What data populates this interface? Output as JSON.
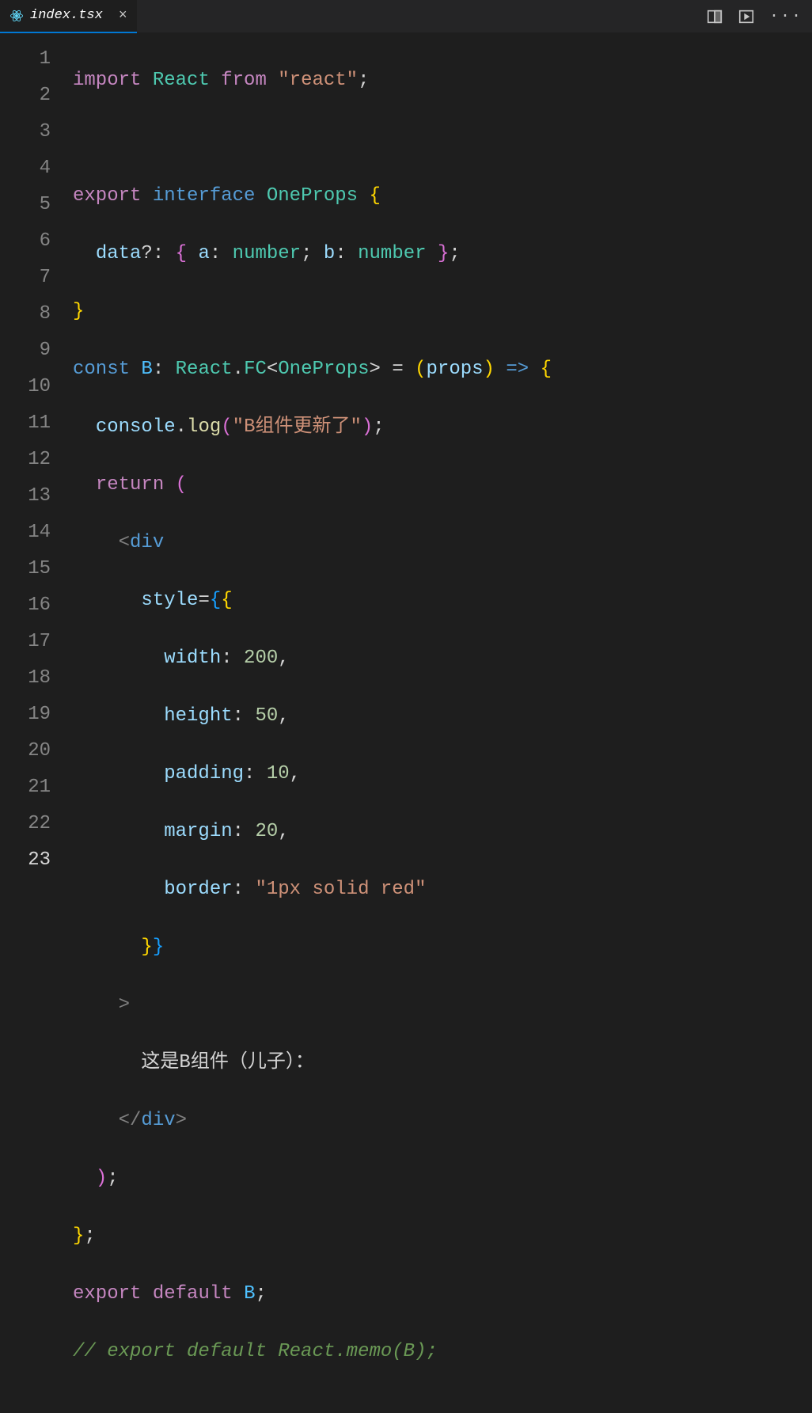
{
  "tab": {
    "filename": "index.tsx",
    "close_glyph": "×"
  },
  "icons": {
    "split": "split-editor-icon",
    "run": "run-cell-icon",
    "more": "···"
  },
  "gutter": {
    "lines": [
      "1",
      "2",
      "3",
      "4",
      "5",
      "6",
      "7",
      "8",
      "9",
      "10",
      "11",
      "12",
      "13",
      "14",
      "15",
      "16",
      "17",
      "18",
      "19",
      "20",
      "21",
      "22",
      "23"
    ],
    "active": "23"
  },
  "code": {
    "l1": {
      "import": "import",
      "react": "React",
      "from": "from",
      "str": "\"react\""
    },
    "l3": {
      "export": "export",
      "interface": "interface",
      "name": "OneProps"
    },
    "l4": {
      "data": "data",
      "qm": "?",
      "a": "a",
      "number1": "number",
      "b": "b",
      "number2": "number"
    },
    "l6": {
      "const": "const",
      "B": "B",
      "React": "React",
      "FC": "FC",
      "OneProps": "OneProps",
      "props": "props"
    },
    "l7": {
      "console": "console",
      "log": "log",
      "str": "\"B组件更新了\""
    },
    "l8": {
      "return": "return"
    },
    "l9": {
      "div": "div"
    },
    "l10": {
      "style": "style"
    },
    "l11": {
      "key": "width",
      "val": "200"
    },
    "l12": {
      "key": "height",
      "val": "50"
    },
    "l13": {
      "key": "padding",
      "val": "10"
    },
    "l14": {
      "key": "margin",
      "val": "20"
    },
    "l15": {
      "key": "border",
      "val": "\"1px solid red\""
    },
    "l18": {
      "text": "这是B组件（儿子）："
    },
    "l19": {
      "div": "div"
    },
    "l22": {
      "export": "export",
      "default": "default",
      "B": "B"
    },
    "l23": {
      "comment": "// export default React.memo(B);"
    }
  }
}
